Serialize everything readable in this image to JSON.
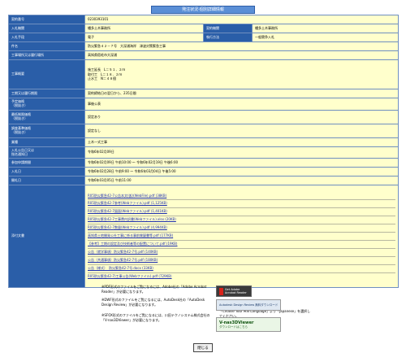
{
  "page_title": "発注状況-個別詳細情報",
  "rows": {
    "contract_no": {
      "label": "契約番号",
      "value": "0230393101"
    },
    "org": {
      "label": "入札機関",
      "value": "幡多土木事務所"
    },
    "contract_org": {
      "label": "契約機関",
      "value": "幡多土木事務所"
    },
    "method": {
      "label": "入札手段",
      "value": "電子"
    },
    "exec_method": {
      "label": "執行方法",
      "value": "一般競争入札"
    },
    "name": {
      "label": "件名",
      "value": "防災緊急４２－７号　大深浦海岸　津波対策緊急工事"
    },
    "place": {
      "label": "工事場所又は履行場所",
      "value": "高知県宿毛市大深浦"
    },
    "outline": {
      "label": "工事概要",
      "lines": [
        "施工延長　L＝５１．２ｍ",
        "　　　　　　　　　　　　　　　　　　　　　　　　　　　　　　　　　　　　　　　　　　　　　　　　　　　　　　　　　　　　　　　　　　　　　　　　　　　　　　　　　　　　　　　　　　　　　　　　　　　　　　　　　　　　　　　　　　　　　　　　　　　　　　　　",
        "取付工　L＝１８．２ｍ",
        "止水工　N＝４８個"
      ]
    },
    "period": {
      "label": "工期又は履行期限",
      "value": "契約締結日の翌日から、235日間"
    },
    "price": {
      "label": "予定価格\n（税抜き）",
      "value": "事後公表"
    },
    "min_price": {
      "label": "最低制限価格\n（税抜き）",
      "value": "設定あり"
    },
    "survey_price": {
      "label": "調査基準価格\n（税抜き）",
      "value": "設定なし"
    },
    "type": {
      "label": "業種",
      "value": "土木一式工事"
    },
    "bid_announce": {
      "label": "入札公告日又は\n指名通知日",
      "value": "令和6年02月09日"
    },
    "app_period": {
      "label": "参加申請期間",
      "value": "令和6年02月09日 午前10:00 〜 令和6年02月19日 午後6:00"
    },
    "bid_period": {
      "label": "入札日",
      "value": "令和6年02月28日 午前9:00 〜 令和6年03月04日 午後5:00"
    },
    "open_date": {
      "label": "開札日",
      "value": "令和6年03月05日 午前11:00"
    },
    "attachments": {
      "label": "添付文書",
      "files": [
        "R05防災緊急42-7公告本文(仮)(WebFile).pdf (38KB)",
        "R05防災緊急42-7参考(Webファイル).pdf (1,125KB)",
        "R05防災緊急42-7図面(Webファイル).pdf (1,401KB)",
        "R05防災緊急42-7工事費内訳書(Webファイル).xlsx (20KB)",
        "R05防災緊急42-7数量(Webファイル).pdf (4,994KB)",
        "高知県土地開発公社工事に係る事前質疑書等.pdf (177KB)",
        "【参考】工期の設定及び技術者等の配置について.pdf (19KB)",
        "公告（就学事項）防災緊急42-7号.pdf (140KB)",
        "公告（共通事項）防災緊急42-7号.pdf (180KB)",
        "公告（様式）　防災緊急42-7号.docx (33KB)",
        "R05防災緊急42-7)工事公告(Webファイル).pdf (729KB)"
      ]
    }
  },
  "notes": {
    "pdf": "※PDF形式のファイルをご覧になるには、Adobe社の「Adobe Acrobat Reader」が必要になります。",
    "dwf": "※DWF形式のファイルをご覧になるには、AutoDesk社の「AutoDesk Design Review」が必要になります。",
    "dwf2": "「Choose Your MSI Language」より「Japanese」を選択してください。",
    "sfox": "※SFOX形式のファイルをご覧になるには、川田テクノシステム株式会社の「V-nas3DViewer」が必要になります。"
  },
  "badges": {
    "adobe": "Get Adobe Acrobat Reader",
    "design_review": "Autodesk Design Review 無料ダウンロード",
    "v3d": "V-nas3DViewer",
    "v3d_sub": "ダウンロードはこちら"
  },
  "close_button": "閉じる"
}
